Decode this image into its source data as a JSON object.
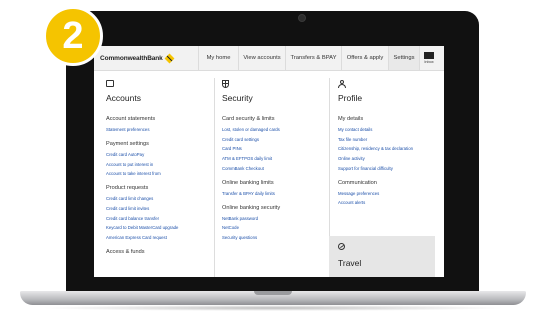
{
  "step_number": "2",
  "nav": {
    "brand": "CommonwealthBank",
    "items": [
      {
        "label": "My home",
        "width": 39
      },
      {
        "label": "View accounts",
        "width": 46
      },
      {
        "label": "Transfers & BPAY",
        "width": 55
      },
      {
        "label": "Offers & apply",
        "width": 46
      },
      {
        "label": "Settings",
        "width": 30,
        "active": true
      }
    ],
    "inbox_label": "Inbox"
  },
  "columns": [
    {
      "icon": "wallet-icon",
      "title": "Accounts",
      "groups": [
        {
          "title": "Account statements",
          "links": [
            "Statement preferences"
          ]
        },
        {
          "title": "Payment settings",
          "links": [
            "Credit card AutoPay",
            "Account to put interest in",
            "Account to take interest from"
          ]
        },
        {
          "title": "Product requests",
          "links": [
            "Credit card limit changes",
            "Credit card limit invites",
            "Credit card balance transfer",
            "Keycard to Debit MasterCard upgrade",
            "American Express Card request"
          ]
        },
        {
          "title": "Access & funds",
          "links": []
        }
      ]
    },
    {
      "icon": "shield-icon",
      "title": "Security",
      "groups": [
        {
          "title": "Card security & limits",
          "links": [
            "Lost, stolen or damaged cards",
            "Credit card settings",
            "Card PINs",
            "ATM & EFTPOS daily limit",
            "CommBank Checkout"
          ]
        },
        {
          "title": "Online banking limits",
          "links": [
            "Transfer & BPAY daily limits"
          ]
        },
        {
          "title": "Online banking security",
          "links": [
            "NetBank password",
            "NetCode",
            "Security questions"
          ]
        }
      ]
    },
    {
      "icon": "person-icon",
      "title": "Profile",
      "groups": [
        {
          "title": "My details",
          "links": [
            "My contact details",
            "Tax file number",
            "Citizenship, residency & tax declaration",
            "Online activity",
            "Support for financial difficulty"
          ]
        },
        {
          "title": "Communication",
          "links": [
            "Message preferences",
            "Account alerts"
          ]
        }
      ]
    }
  ],
  "travel": {
    "title": "Travel",
    "icon": "compass-icon"
  }
}
